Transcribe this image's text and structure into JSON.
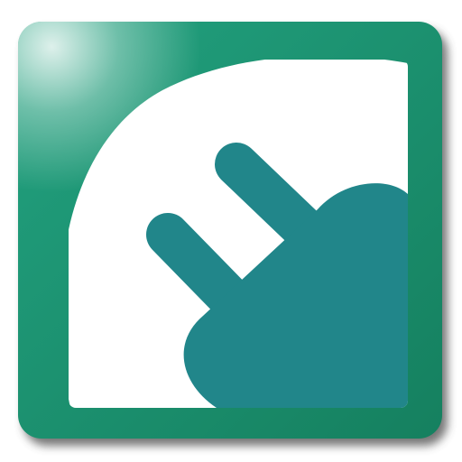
{
  "icon": {
    "name": "power-plug-icon",
    "colors": {
      "tile": "#22a17f",
      "tile_dark": "#15805f",
      "tile_shadow": "#4a4a4a",
      "panel": "#ffffff",
      "plug": "#21868a"
    }
  }
}
